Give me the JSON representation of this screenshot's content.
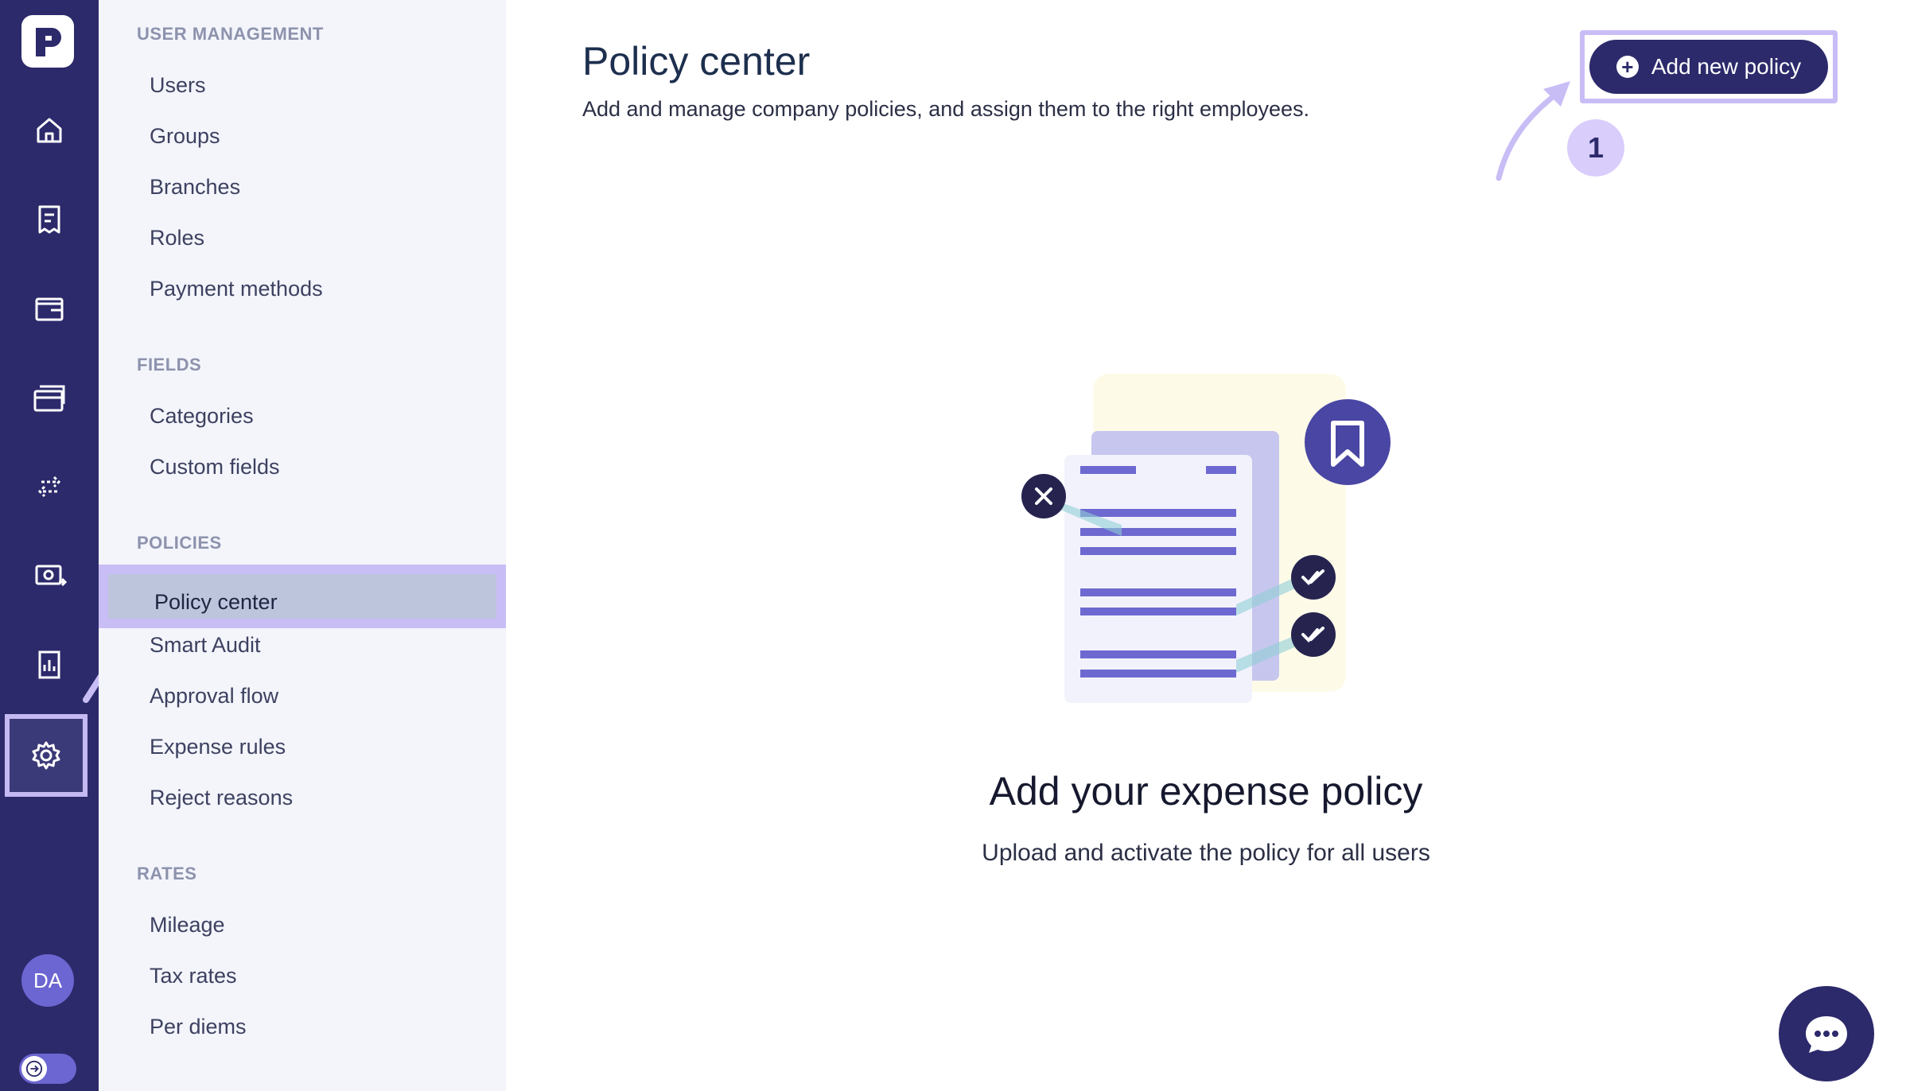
{
  "rail": {
    "icons": [
      "logo-icon",
      "home-icon",
      "receipt-icon",
      "wallet-icon",
      "cards-icon",
      "transfer-icon",
      "reimburse-icon",
      "reports-icon",
      "settings-icon"
    ],
    "avatar": "DA",
    "accent": "#2c2a6b"
  },
  "sidebar": {
    "sections": [
      {
        "title": "USER MANAGEMENT",
        "items": [
          "Users",
          "Groups",
          "Branches",
          "Roles",
          "Payment methods"
        ]
      },
      {
        "title": "FIELDS",
        "items": [
          "Categories",
          "Custom fields"
        ]
      },
      {
        "title": "POLICIES",
        "items": [
          "Policy center",
          "Smart Audit",
          "Approval flow",
          "Expense rules",
          "Reject reasons"
        ]
      },
      {
        "title": "RATES",
        "items": [
          "Mileage",
          "Tax rates",
          "Per diems"
        ]
      }
    ],
    "active_item": "Policy center"
  },
  "header": {
    "title": "Policy center",
    "subtitle": "Add and manage company policies, and assign them to the right employees.",
    "add_button": "Add new policy",
    "step_badge": "1"
  },
  "empty_state": {
    "title": "Add your expense policy",
    "subtitle": "Upload and activate the policy for all users"
  },
  "colors": {
    "highlight": "#c9bdf6",
    "sidebar_bg": "#f3f5fb"
  }
}
